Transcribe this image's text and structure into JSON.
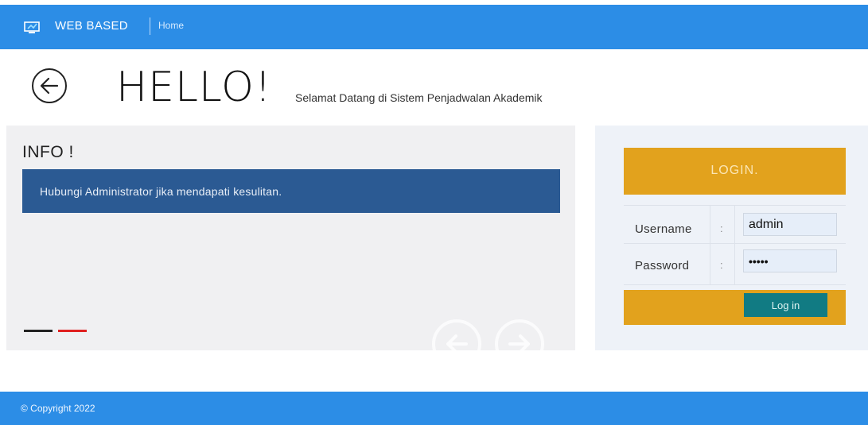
{
  "header": {
    "brand": "WEB BASED",
    "nav_home": "Home",
    "icon": "monitor-icon"
  },
  "hero": {
    "back_icon": "back-arrow-icon",
    "title": "HELLO!",
    "subtitle": "Selamat Datang di Sistem Penjadwalan Akademik"
  },
  "info": {
    "title": "INFO !",
    "message": "Hubungi Administrator jika mendapati kesulitan.",
    "indicators": [
      "slide-1",
      "slide-2"
    ],
    "nav": {
      "prev_icon": "arrow-left-circle-icon",
      "next_icon": "arrow-right-circle-icon"
    }
  },
  "login": {
    "heading": "LOGIN.",
    "username_label": "Username",
    "password_label": "Password",
    "separator": ":",
    "username_value": "admin",
    "password_value": "•••••",
    "button_label": "Log in"
  },
  "footer": {
    "copyright": "© Copyright 2022"
  },
  "colors": {
    "topbar": "#2c8de6",
    "login_accent": "#e2a21d",
    "info_alert": "#2b5a93",
    "button": "#117b83",
    "indicator_active": "#e02020"
  }
}
